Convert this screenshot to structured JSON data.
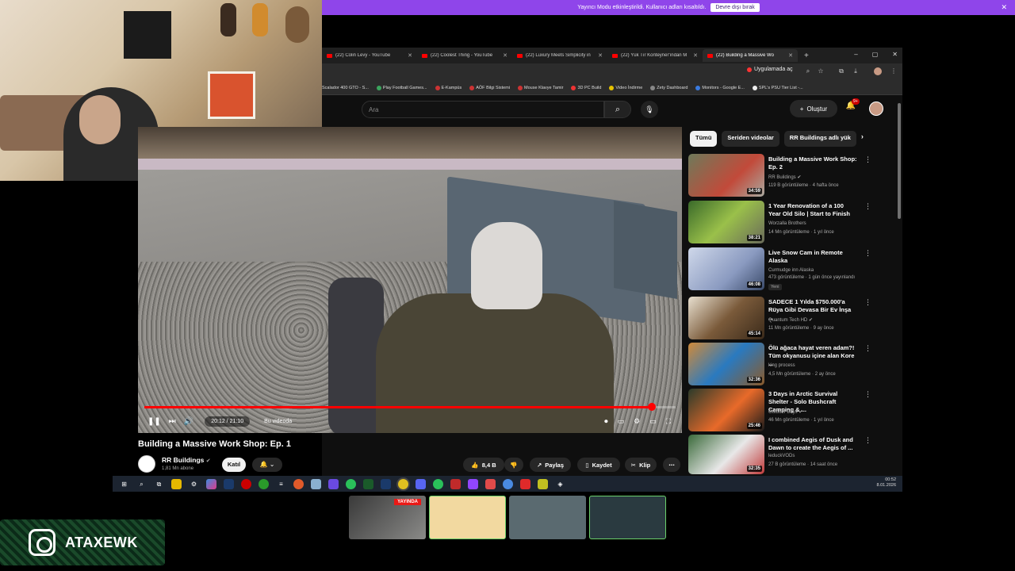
{
  "banner": {
    "text": "Yayıncı Modu etkinleştirildi. Kullanıcı adları kısaltıldı.",
    "button": "Devre dışı bırak"
  },
  "tabs": [
    {
      "label": "(22) Colin Levy - YouTube"
    },
    {
      "label": "(22) Coolest Thing - YouTube"
    },
    {
      "label": "(22) Luxury Meets Simplicity in"
    },
    {
      "label": "(22) Yük Tır Konteyner'ından M"
    },
    {
      "label": "(22) Building a Massive Wo",
      "active": true
    }
  ],
  "address": {
    "open_in_app": "Uygulamada aç"
  },
  "bookmarks": [
    "Scalador 400 GTO - S...",
    "Play Football Games...",
    "E-Kampüs",
    "AÖF Bilgi Sistemi",
    "Mouse Klavye Tamir",
    "3D PC Build",
    "Video İndirme",
    "Zety Dashboard",
    "Monitors - Google E...",
    "SPL's PSU Tier List -..."
  ],
  "youtube": {
    "search_placeholder": "Ara",
    "create": "Oluştur",
    "notif_badge": "9+"
  },
  "video": {
    "time": "20:12 / 21:10",
    "chapter": "Bu videoda",
    "progress": 0.955,
    "title": "Building a Massive Work Shop: Ep. 1",
    "channel": "RR Buildings",
    "subs": "1,81 Mn abone",
    "join": "Katıl",
    "likes": "8,4 B",
    "share": "Paylaş",
    "save": "Kaydet",
    "clip": "Klip"
  },
  "chips": [
    "Tümü",
    "Seriden videolar",
    "RR Buildings adlı yük"
  ],
  "recommendations": [
    {
      "title": "Building a Massive Work Shop: Ep. 2",
      "channel": "RR Buildings",
      "meta": "119 B görüntüleme · 4 hafta önce",
      "duration": "34:59"
    },
    {
      "title": "1 Year Renovation of a 100 Year Old Silo | Start to Finish",
      "channel": "Worzalla Brothers",
      "meta": "14 Mn görüntüleme · 1 yıl önce",
      "duration": "38:21"
    },
    {
      "title": "Live Snow Cam in Remote Alaska",
      "channel": "Curmudge inn Alaska",
      "meta": "473 görüntüleme · 1 gün önce yayınlandı",
      "duration": "46:08",
      "badge": "Yeni"
    },
    {
      "title": "SADECE 1 Yılda $750.000'a Rüya Gibi Devasa Bir Ev İnşa ...",
      "channel": "Quantum Tech HD",
      "meta": "11 Mn görüntüleme · 9 ay önce",
      "duration": "45:14"
    },
    {
      "title": "Ölü ağaca hayat veren adam?! Tüm okyanusu içine alan Kore ...",
      "channel": "king process",
      "meta": "4,5 Mn görüntüleme · 2 ay önce",
      "duration": "32:36"
    },
    {
      "title": "3 Days in Arctic Survival Shelter - Solo Bushcraft Camping & ...",
      "channel": "Outdoor Boys",
      "meta": "46 Mn görüntüleme · 1 yıl önce",
      "duration": "25:46"
    },
    {
      "title": "I combined Aegis of Dusk and Dawn to create the Aegis of ...",
      "channel": "leduckVODs",
      "meta": "27 B görüntüleme · 14 saat önce",
      "duration": "32:35"
    }
  ],
  "taskbar": {
    "time": "00:52",
    "date": "8.01.2026"
  },
  "overlay": {
    "live": "YAYINDA",
    "instagram": "ATAXEWK"
  }
}
